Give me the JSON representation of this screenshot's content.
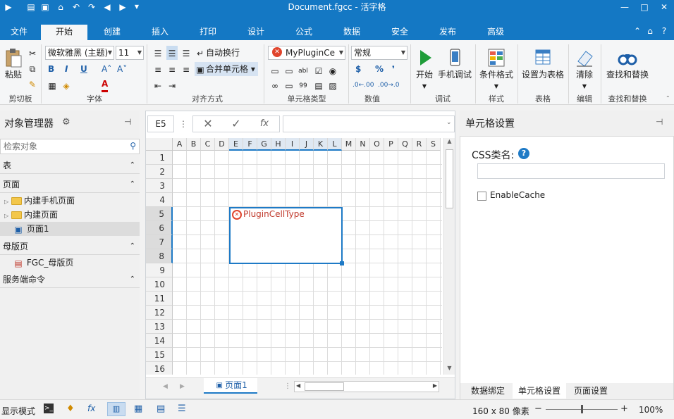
{
  "title": "Document.fgcc - 活字格",
  "ribbon_tabs": [
    "文件",
    "开始",
    "创建",
    "插入",
    "打印",
    "设计",
    "公式",
    "数据",
    "安全",
    "发布",
    "高级"
  ],
  "clipboard": {
    "paste": "粘贴",
    "group": "剪切板"
  },
  "font": {
    "name": "微软雅黑 (主题)",
    "size": "11",
    "bold": "B",
    "italic": "I",
    "underline": "U",
    "inc": "A˄",
    "dec": "A˅",
    "fontcolor": "A",
    "group": "字体"
  },
  "align": {
    "wrap": "自动换行",
    "merge": "合并单元格",
    "group": "对齐方式"
  },
  "celltype": {
    "selected": "MyPluginCe",
    "group": "单元格类型"
  },
  "number": {
    "format": "常规",
    "currency": "$",
    "percent": "%",
    "comma": "❜",
    "group": "数值"
  },
  "debug": {
    "start": "开始",
    "mobile": "手机调试",
    "group": "调试"
  },
  "style": {
    "cond": "条件格式",
    "group": "样式"
  },
  "table": {
    "settable": "设置为表格",
    "group": "表格"
  },
  "edit": {
    "clear": "清除",
    "group": "编辑"
  },
  "find": {
    "label": "查找和替换",
    "group": "查找和替换"
  },
  "objpanel": {
    "title": "对象管理器",
    "search_placeholder": "检索对象",
    "sections": [
      "表",
      "页面",
      "母版页",
      "服务端命令"
    ],
    "page_items": [
      "内建手机页面",
      "内建页面",
      "页面1"
    ],
    "master_items": [
      "FGC_母版页"
    ]
  },
  "formula": {
    "cellref": "E5",
    "more": "⋮",
    "cancel": "✕",
    "ok": "✓",
    "fx": "fx",
    "value": ""
  },
  "grid": {
    "columns": [
      "A",
      "B",
      "C",
      "D",
      "E",
      "F",
      "G",
      "H",
      "I",
      "J",
      "K",
      "L",
      "M",
      "N",
      "O",
      "P",
      "Q",
      "R",
      "S"
    ],
    "rows": [
      "1",
      "2",
      "3",
      "4",
      "5",
      "6",
      "7",
      "8",
      "9",
      "10",
      "11",
      "12",
      "13",
      "14",
      "15",
      "16"
    ],
    "plugin_cell": "PluginCellType"
  },
  "sheet_tab": "页面1",
  "rightpanel": {
    "title": "单元格设置",
    "css_label": "CSS类名:",
    "css_value": "",
    "enable_cache": "EnableCache",
    "tabs": [
      "数据绑定",
      "单元格设置",
      "页面设置"
    ]
  },
  "status": {
    "mode": "显示模式",
    "size": "160 x 80 像素",
    "zoom": "100%"
  }
}
